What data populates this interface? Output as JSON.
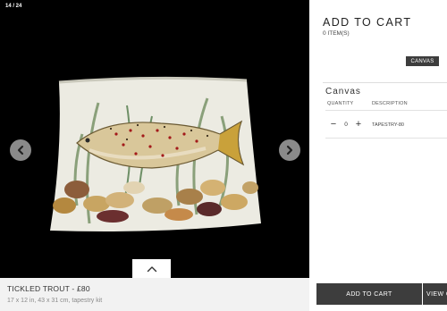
{
  "gallery": {
    "counter": "14 / 24",
    "image_alt": "Tickled Trout tapestry cushion",
    "prev_icon": "chevron-left-icon",
    "next_icon": "chevron-right-icon",
    "toggle_icon": "chevron-up-icon"
  },
  "caption": {
    "title": "TICKLED TROUT - £80",
    "subtitle": "17 x 12 in, 43 x 31 cm, tapestry kit"
  },
  "cart": {
    "title": "ADD TO CART",
    "count": "0 ITEM(S)",
    "badge": "CANVAS",
    "section_title": "Canvas",
    "columns": {
      "quantity": "QUANTITY",
      "description": "DESCRIPTION"
    },
    "row": {
      "quantity": "0",
      "description": "TAPESTRY-80"
    },
    "add_button": "ADD TO CART",
    "view_button": "VIEW CART"
  },
  "colors": {
    "gallery_bg": "#000000",
    "button_bg": "#3d3d3d",
    "caption_bg": "#f2f2f2"
  }
}
